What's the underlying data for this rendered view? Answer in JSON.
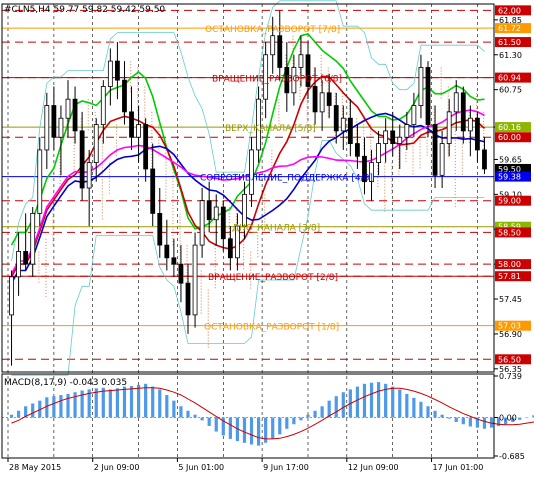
{
  "header": {
    "symbol_line": "#CLN5,H4 59.77 59.82 59.42 59.50",
    "macd_line": "MACD(8,17,9) -0.043 0.035"
  },
  "chart_data": {
    "type": "candlestick",
    "symbol": "#CLN5",
    "timeframe": "H4",
    "ohlc": {
      "open": 59.77,
      "high": 59.82,
      "low": 59.42,
      "close": 59.5
    },
    "ylim": [
      56.3,
      62.1
    ],
    "price_ticks": [
      "61.85",
      "61.30",
      "60.75",
      "60.16",
      "59.65",
      "59.10",
      "58.55",
      "58.00",
      "57.45",
      "56.90",
      "56.35"
    ],
    "x_ticks": [
      "28 May 2015",
      "2 Jun 09:00",
      "5 Jun 01:00",
      "9 Jun 17:00",
      "12 Jun 09:00",
      "17 Jun 01:00"
    ],
    "murrey_levels": [
      {
        "text": "ОСТАНОВКА_РАЗВОРОТ [7/8]",
        "price": 61.72,
        "color": "#ff9900"
      },
      {
        "text": "ВРАЩЕНИЕ_РАЗВОРОТ [6/8]",
        "price": 60.94,
        "color": "#cc0000"
      },
      {
        "text": "ВЕРХ_КАНАЛА [5/8]",
        "price": 60.16,
        "color": "#999900"
      },
      {
        "text": "СОПРОТИВЛЕНИЕ_ПОДДЕРЖКА [4/8]",
        "price": 59.38,
        "color": "#0000ee"
      },
      {
        "text": "ДНО_КАНАЛА [3/8]",
        "price": 58.59,
        "color": "#999900"
      },
      {
        "text": "ВРАЩЕНИЕ_РАЗВОРОТ [2/8]",
        "price": 57.81,
        "color": "#cc0000"
      },
      {
        "text": "ОСТАНОВКА_РАЗВОРОТ [1/8]",
        "price": 57.03,
        "color": "#ff9900"
      }
    ],
    "price_badges": [
      {
        "text": "62.00",
        "price": 62.0,
        "color": "#cc0000"
      },
      {
        "text": "61.72",
        "price": 61.72,
        "color": "#ff9900"
      },
      {
        "text": "61.50",
        "price": 61.5,
        "color": "#cc0000"
      },
      {
        "text": "60.94",
        "price": 60.94,
        "color": "#cc0000"
      },
      {
        "text": "60.16",
        "price": 60.16,
        "color": "#8db600"
      },
      {
        "text": "60.00",
        "price": 60.0,
        "color": "#cc0000"
      },
      {
        "text": "59.50",
        "price": 59.5,
        "color": "#000000"
      },
      {
        "text": "59.38",
        "price": 59.38,
        "color": "#0000ee"
      },
      {
        "text": "59.00",
        "price": 59.0,
        "color": "#cc0000"
      },
      {
        "text": "58.59",
        "price": 58.59,
        "color": "#8db600"
      },
      {
        "text": "58.50",
        "price": 58.5,
        "color": "#cc0000"
      },
      {
        "text": "58.00",
        "price": 58.0,
        "color": "#cc0000"
      },
      {
        "text": "57.81",
        "price": 57.81,
        "color": "#cc0000"
      },
      {
        "text": "57.03",
        "price": 57.03,
        "color": "#ff9900"
      },
      {
        "text": "56.50",
        "price": 56.5,
        "color": "#cc0000"
      }
    ],
    "round_levels": [
      62.0,
      61.5,
      60.94,
      60.0,
      59.0,
      58.5,
      58.0,
      57.81,
      56.5
    ],
    "macd": {
      "params": "8,17,9",
      "value": -0.043,
      "signal": 0.035,
      "ylim": [
        -0.685,
        0.739
      ],
      "ticks": [
        "0.739",
        "0.00",
        "-0.685"
      ],
      "histogram": [
        0.05,
        0.12,
        0.2,
        0.25,
        0.3,
        0.36,
        0.38,
        0.4,
        0.42,
        0.45,
        0.48,
        0.5,
        0.52,
        0.53,
        0.5,
        0.52,
        0.55,
        0.56,
        0.58,
        0.6,
        0.55,
        0.5,
        0.4,
        0.3,
        0.2,
        0.12,
        0.05,
        -0.05,
        -0.15,
        -0.25,
        -0.32,
        -0.38,
        -0.42,
        -0.45,
        -0.48,
        -0.5,
        -0.45,
        -0.38,
        -0.3,
        -0.2,
        -0.12,
        -0.05,
        0.05,
        0.12,
        0.2,
        0.3,
        0.38,
        0.45,
        0.5,
        0.55,
        0.6,
        0.62,
        0.63,
        0.6,
        0.55,
        0.5,
        0.42,
        0.35,
        0.28,
        0.2,
        0.12,
        0.05,
        -0.02,
        -0.08,
        -0.12,
        -0.16,
        -0.18,
        -0.2,
        -0.18,
        -0.15,
        -0.12,
        -0.08,
        -0.04,
        0.0,
        0.04,
        0.08,
        0.1,
        0.08,
        -0.02,
        -0.05,
        0.02,
        0.06,
        0.1,
        0.12,
        0.1,
        0.05,
        -0.02
      ],
      "signal_line": [
        -0.1,
        -0.05,
        0.02,
        0.08,
        0.14,
        0.2,
        0.25,
        0.3,
        0.34,
        0.37,
        0.4,
        0.43,
        0.45,
        0.47,
        0.48,
        0.49,
        0.5,
        0.51,
        0.52,
        0.53,
        0.53,
        0.52,
        0.49,
        0.45,
        0.4,
        0.33,
        0.26,
        0.18,
        0.1,
        0.02,
        -0.06,
        -0.13,
        -0.2,
        -0.26,
        -0.31,
        -0.36,
        -0.38,
        -0.38,
        -0.37,
        -0.34,
        -0.3,
        -0.25,
        -0.19,
        -0.12,
        -0.05,
        0.03,
        0.1,
        0.18,
        0.25,
        0.31,
        0.37,
        0.42,
        0.47,
        0.5,
        0.52,
        0.52,
        0.5,
        0.47,
        0.43,
        0.38,
        0.32,
        0.26,
        0.19,
        0.13,
        0.07,
        0.02,
        -0.03,
        -0.07,
        -0.1,
        -0.12,
        -0.13,
        -0.13,
        -0.12,
        -0.1,
        -0.08,
        -0.05,
        -0.03,
        -0.01,
        0.0,
        0.0,
        0.0,
        0.01,
        0.02,
        0.03,
        0.04,
        0.04,
        0.04
      ]
    },
    "candles": [
      [
        57.2,
        57.9,
        56.4,
        57.8
      ],
      [
        57.8,
        58.5,
        57.5,
        58.2
      ],
      [
        58.2,
        58.8,
        57.9,
        58.0
      ],
      [
        58.0,
        58.9,
        57.8,
        58.8
      ],
      [
        58.8,
        60.0,
        58.6,
        59.8
      ],
      [
        59.8,
        60.7,
        59.5,
        60.5
      ],
      [
        60.5,
        60.8,
        59.8,
        60.0
      ],
      [
        60.0,
        60.5,
        59.4,
        60.3
      ],
      [
        60.3,
        60.9,
        60.0,
        60.6
      ],
      [
        60.6,
        60.8,
        59.9,
        60.1
      ],
      [
        60.1,
        60.4,
        59.0,
        59.2
      ],
      [
        59.2,
        59.8,
        58.6,
        59.6
      ],
      [
        59.6,
        60.3,
        59.3,
        60.2
      ],
      [
        60.2,
        60.9,
        59.9,
        60.8
      ],
      [
        60.8,
        61.4,
        60.5,
        61.2
      ],
      [
        61.2,
        61.5,
        60.6,
        60.9
      ],
      [
        60.9,
        61.2,
        60.2,
        60.4
      ],
      [
        60.4,
        60.8,
        59.8,
        60.0
      ],
      [
        60.0,
        60.5,
        59.6,
        60.2
      ],
      [
        60.2,
        60.3,
        59.3,
        59.5
      ],
      [
        59.5,
        59.9,
        58.6,
        58.8
      ],
      [
        58.8,
        59.2,
        58.1,
        58.3
      ],
      [
        58.3,
        58.7,
        57.9,
        58.1
      ],
      [
        58.1,
        58.4,
        57.8,
        58.0
      ],
      [
        58.0,
        58.3,
        57.4,
        57.7
      ],
      [
        57.7,
        58.0,
        56.9,
        57.2
      ],
      [
        57.2,
        58.5,
        57.0,
        58.3
      ],
      [
        58.3,
        59.2,
        58.1,
        59.0
      ],
      [
        59.0,
        59.3,
        58.5,
        58.7
      ],
      [
        58.7,
        59.1,
        58.3,
        58.9
      ],
      [
        58.9,
        59.0,
        58.2,
        58.4
      ],
      [
        58.4,
        58.6,
        57.9,
        58.1
      ],
      [
        58.1,
        58.8,
        57.9,
        58.6
      ],
      [
        58.6,
        59.3,
        58.4,
        59.1
      ],
      [
        59.1,
        60.0,
        58.9,
        59.8
      ],
      [
        59.8,
        60.8,
        59.6,
        60.6
      ],
      [
        60.6,
        61.5,
        60.3,
        61.3
      ],
      [
        61.3,
        61.9,
        61.0,
        61.6
      ],
      [
        61.6,
        62.0,
        60.9,
        61.1
      ],
      [
        61.1,
        61.5,
        60.4,
        60.7
      ],
      [
        60.7,
        61.3,
        60.5,
        61.1
      ],
      [
        61.1,
        61.6,
        60.8,
        61.3
      ],
      [
        61.3,
        61.5,
        60.6,
        60.8
      ],
      [
        60.8,
        61.1,
        60.2,
        60.4
      ],
      [
        60.4,
        60.9,
        60.1,
        60.7
      ],
      [
        60.7,
        61.0,
        60.3,
        60.5
      ],
      [
        60.5,
        60.7,
        59.9,
        60.1
      ],
      [
        60.1,
        60.5,
        59.8,
        60.3
      ],
      [
        60.3,
        60.6,
        59.7,
        59.9
      ],
      [
        59.9,
        60.2,
        59.5,
        59.7
      ],
      [
        59.7,
        60.0,
        59.1,
        59.3
      ],
      [
        59.3,
        59.8,
        59.0,
        59.6
      ],
      [
        59.6,
        60.1,
        59.4,
        59.9
      ],
      [
        59.9,
        60.3,
        59.6,
        60.1
      ],
      [
        60.1,
        60.4,
        59.7,
        59.9
      ],
      [
        59.9,
        60.2,
        59.5,
        60.0
      ],
      [
        60.0,
        60.4,
        59.8,
        60.2
      ],
      [
        60.2,
        60.7,
        60.0,
        60.5
      ],
      [
        60.5,
        61.3,
        60.3,
        61.1
      ],
      [
        61.1,
        61.2,
        60.0,
        60.2
      ],
      [
        60.2,
        60.5,
        59.2,
        59.4
      ],
      [
        59.4,
        60.1,
        59.2,
        59.9
      ],
      [
        59.9,
        60.6,
        59.7,
        60.4
      ],
      [
        60.4,
        60.9,
        60.1,
        60.7
      ],
      [
        60.7,
        60.8,
        59.9,
        60.1
      ],
      [
        60.1,
        60.5,
        59.7,
        60.3
      ],
      [
        60.3,
        60.4,
        59.6,
        59.8
      ],
      [
        59.8,
        60.0,
        59.42,
        59.5
      ]
    ]
  }
}
